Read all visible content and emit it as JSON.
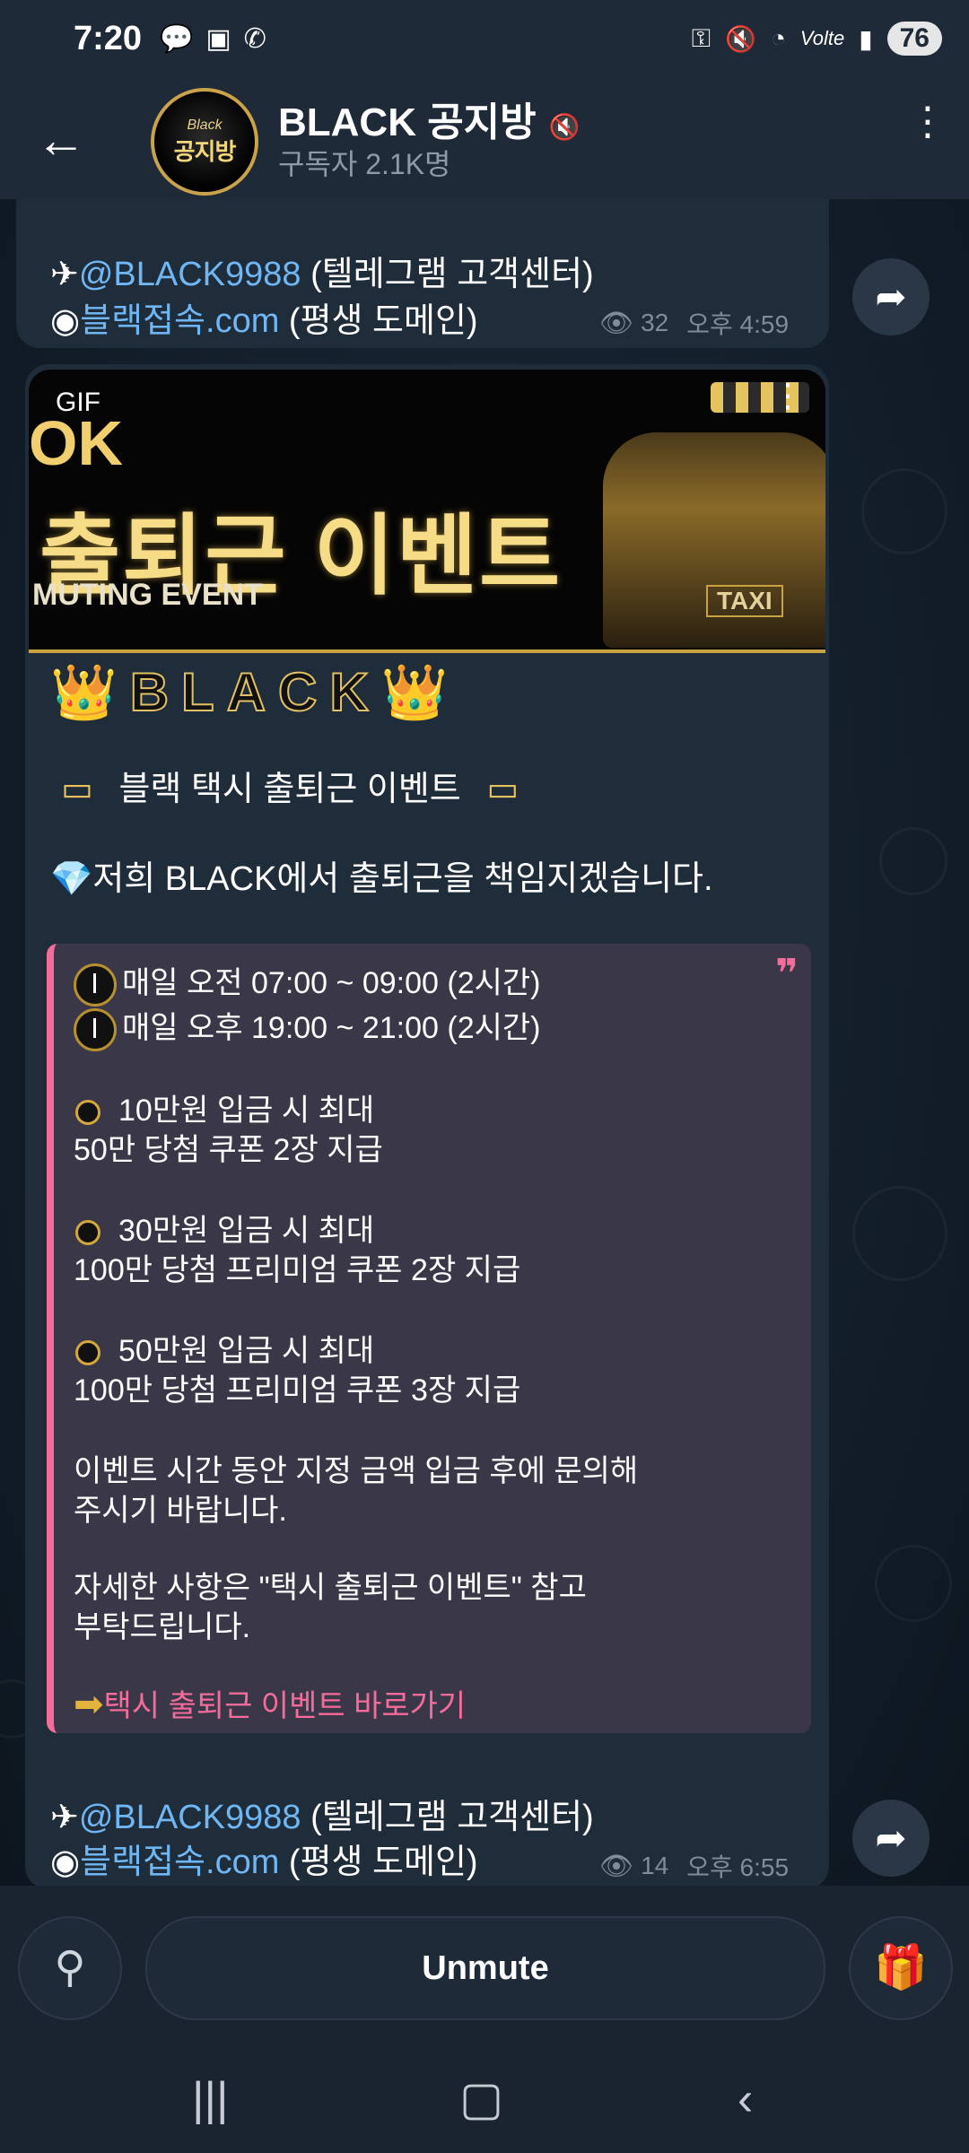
{
  "status_bar": {
    "time": "7:20",
    "left_icons": [
      "talk-icon",
      "screenshot-icon",
      "whatsapp-icon"
    ],
    "right_icons": [
      "key-icon",
      "mute-icon",
      "wifi-icon",
      "volte-icon",
      "signal-icon"
    ],
    "volte": "Volte",
    "battery": "76"
  },
  "header": {
    "title": "BLACK 공지방",
    "subtitle": "구독자 2.1K명",
    "avatar_text_top": "Black",
    "avatar_text_main": "공지방"
  },
  "messages": [
    {
      "telegram_handle": "@BLACK9988",
      "telegram_desc": " (텔레그램 고객센터)",
      "domain_link": "블랙접속.com",
      "domain_desc": " (평생 도메인)",
      "views": "32",
      "time": "오후 4:59"
    },
    {
      "banner": {
        "gif_label": "GIF",
        "ok_text": "OK",
        "event_text": "출퇴근 이벤트",
        "commuting_text": "MUTING EVENT",
        "taxi_text": "TAXI"
      },
      "brand": "BLACK",
      "headline": "블랙 택시 출퇴근 이벤트",
      "intro": "저희 BLACK에서 출퇴근을 책임지겠습니다.",
      "quote": {
        "schedule_1": "매일 오전 07:00 ~ 09:00 (2시간)",
        "schedule_2": "매일 오후 19:00 ~ 21:00 (2시간)",
        "tier_1_a": "10만원 입금 시 최대",
        "tier_1_b": "50만 당첨 쿠폰 2장 지급",
        "tier_2_a": "30만원 입금 시 최대",
        "tier_2_b": "100만 당첨 프리미엄 쿠폰 2장 지급",
        "tier_3_a": "50만원 입금 시 최대",
        "tier_3_b": "100만 당첨 프리미엄 쿠폰 3장 지급",
        "note_1a": "이벤트 시간 동안 지정 금액 입금 후에 문의해",
        "note_1b": "주시기 바랍니다.",
        "note_2a": "자세한 사항은 \"택시 출퇴근 이벤트\" 참고",
        "note_2b": "부탁드립니다.",
        "link": "택시 출퇴근 이벤트 바로가기"
      },
      "telegram_handle": "@BLACK9988",
      "telegram_desc": " (텔레그램 고객센터)",
      "domain_link": "블랙접속.com",
      "domain_desc": " (평생 도메인)",
      "views": "14",
      "time": "오후 6:55"
    }
  ],
  "bottom": {
    "unmute_label": "Unmute"
  }
}
